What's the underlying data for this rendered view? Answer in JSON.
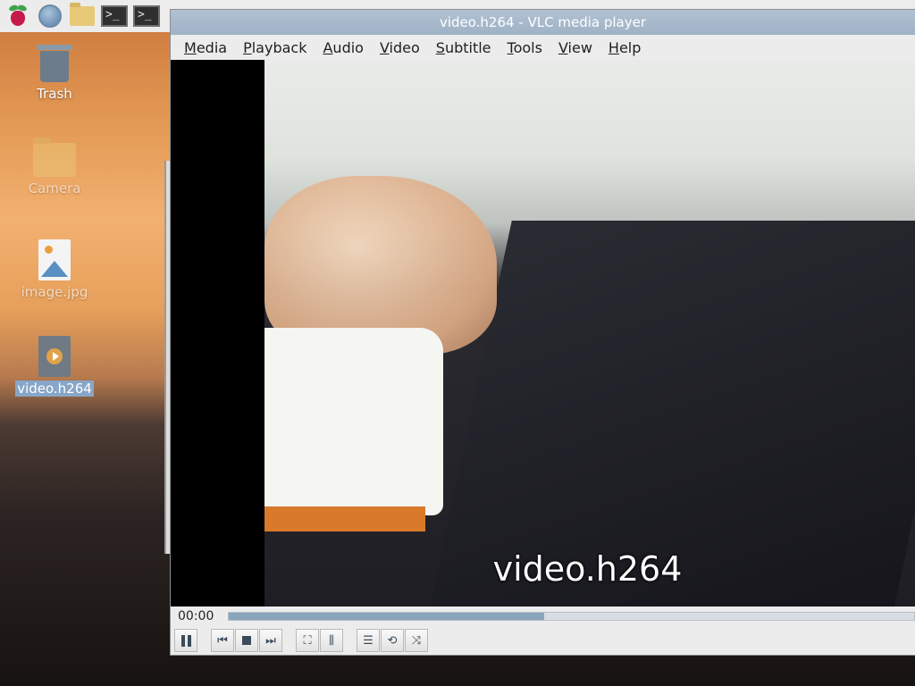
{
  "taskbar": {
    "icons": [
      "raspberry-pi-menu-icon",
      "web-browser-icon",
      "file-manager-icon",
      "terminal-icon",
      "terminal-icon"
    ],
    "terminal_glyph": ">_"
  },
  "desktop": {
    "icons": [
      {
        "label": "Trash",
        "icon": "trash-icon"
      },
      {
        "label": "Camera",
        "icon": "folder-icon"
      },
      {
        "label": "image.jpg",
        "icon": "image-file-icon"
      },
      {
        "label": "video.h264",
        "icon": "video-file-icon",
        "selected": true
      }
    ]
  },
  "vlc": {
    "title": "video.h264 - VLC media player",
    "menu": [
      "Media",
      "Playback",
      "Audio",
      "Video",
      "Subtitle",
      "Tools",
      "View",
      "Help"
    ],
    "video_overlay_text": "video.h264",
    "time_elapsed": "00:00",
    "seek_progress_fraction": 0.46,
    "controls": [
      {
        "name": "pause-button",
        "icon": "pause-icon"
      },
      {
        "name": "previous-button",
        "icon": "skip-previous-icon"
      },
      {
        "name": "stop-button",
        "icon": "stop-icon"
      },
      {
        "name": "next-button",
        "icon": "skip-next-icon"
      },
      {
        "name": "fullscreen-button",
        "icon": "fullscreen-icon"
      },
      {
        "name": "extended-settings-button",
        "icon": "equalizer-icon"
      },
      {
        "name": "playlist-button",
        "icon": "playlist-icon"
      },
      {
        "name": "loop-button",
        "icon": "loop-icon"
      },
      {
        "name": "shuffle-button",
        "icon": "shuffle-icon"
      }
    ]
  },
  "colors": {
    "titlebar": "#9fb2c6",
    "selection": "#87a6c8",
    "seek_fill": "#8aa4bc"
  }
}
